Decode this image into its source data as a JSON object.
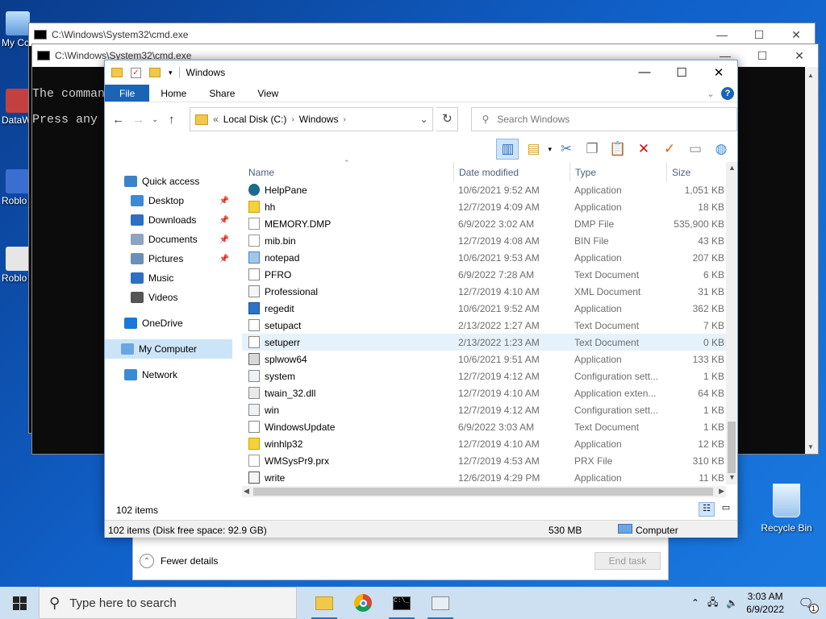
{
  "desktop": {
    "icons": [
      {
        "label": "My Co",
        "icon": "computer-icon"
      },
      {
        "label": "DataW",
        "icon": "app-icon"
      },
      {
        "label": "Roblo",
        "icon": "roblox-icon"
      },
      {
        "label": "Roblo",
        "icon": "roblox-icon"
      }
    ],
    "recycle_bin": "Recycle Bin"
  },
  "task_manager": {
    "fewer_details": "Fewer details",
    "end_task": "End task"
  },
  "cmd_back": {
    "title": "C:\\Windows\\System32\\cmd.exe"
  },
  "cmd_front": {
    "title": "C:\\Windows\\System32\\cmd.exe",
    "lines": [
      "The command",
      "Press any k"
    ]
  },
  "explorer": {
    "title": "Windows",
    "ribbon_tabs": [
      "File",
      "Home",
      "Share",
      "View"
    ],
    "address": {
      "prefix": "«",
      "crumbs": [
        "Local Disk (C:)",
        "Windows"
      ]
    },
    "search_placeholder": "Search Windows",
    "nav": [
      {
        "label": "Quick access",
        "icon": "star-icon"
      },
      {
        "label": "Desktop",
        "icon": "desktop-icon",
        "pinned": true
      },
      {
        "label": "Downloads",
        "icon": "download-icon",
        "pinned": true
      },
      {
        "label": "Documents",
        "icon": "document-icon",
        "pinned": true
      },
      {
        "label": "Pictures",
        "icon": "picture-icon",
        "pinned": true
      },
      {
        "label": "Music",
        "icon": "music-icon"
      },
      {
        "label": "Videos",
        "icon": "video-icon"
      },
      {
        "label": "OneDrive",
        "icon": "cloud-icon"
      },
      {
        "label": "My Computer",
        "icon": "computer-icon",
        "selected": true
      },
      {
        "label": "Network",
        "icon": "network-icon"
      }
    ],
    "columns": [
      "Name",
      "Date modified",
      "Type",
      "Size"
    ],
    "files": [
      {
        "name": "HelpPane",
        "date": "10/6/2021 9:52 AM",
        "type": "Application",
        "size": "1,051 KB",
        "icon": "help-icon"
      },
      {
        "name": "hh",
        "date": "12/7/2019 4:09 AM",
        "type": "Application",
        "size": "18 KB",
        "icon": "help-question-icon"
      },
      {
        "name": "MEMORY.DMP",
        "date": "6/9/2022 3:02 AM",
        "type": "DMP File",
        "size": "535,900 KB",
        "icon": "file-icon"
      },
      {
        "name": "mib.bin",
        "date": "12/7/2019 4:08 AM",
        "type": "BIN File",
        "size": "43 KB",
        "icon": "file-icon"
      },
      {
        "name": "notepad",
        "date": "10/6/2021 9:53 AM",
        "type": "Application",
        "size": "207 KB",
        "icon": "notepad-icon"
      },
      {
        "name": "PFRO",
        "date": "6/9/2022 7:28 AM",
        "type": "Text Document",
        "size": "6 KB",
        "icon": "text-file-icon"
      },
      {
        "name": "Professional",
        "date": "12/7/2019 4:10 AM",
        "type": "XML Document",
        "size": "31 KB",
        "icon": "xml-file-icon"
      },
      {
        "name": "regedit",
        "date": "10/6/2021 9:52 AM",
        "type": "Application",
        "size": "362 KB",
        "icon": "regedit-icon"
      },
      {
        "name": "setupact",
        "date": "2/13/2022 1:27 AM",
        "type": "Text Document",
        "size": "7 KB",
        "icon": "text-file-icon"
      },
      {
        "name": "setuperr",
        "date": "2/13/2022 1:23 AM",
        "type": "Text Document",
        "size": "0 KB",
        "icon": "text-file-icon",
        "highlight": true
      },
      {
        "name": "splwow64",
        "date": "10/6/2021 9:51 AM",
        "type": "Application",
        "size": "133 KB",
        "icon": "printer-icon"
      },
      {
        "name": "system",
        "date": "12/7/2019 4:12 AM",
        "type": "Configuration sett...",
        "size": "1 KB",
        "icon": "config-file-icon"
      },
      {
        "name": "twain_32.dll",
        "date": "12/7/2019 4:10 AM",
        "type": "Application exten...",
        "size": "64 KB",
        "icon": "dll-file-icon"
      },
      {
        "name": "win",
        "date": "12/7/2019 4:12 AM",
        "type": "Configuration sett...",
        "size": "1 KB",
        "icon": "config-file-icon"
      },
      {
        "name": "WindowsUpdate",
        "date": "6/9/2022 3:03 AM",
        "type": "Text Document",
        "size": "1 KB",
        "icon": "text-file-icon"
      },
      {
        "name": "winhlp32",
        "date": "12/7/2019 4:10 AM",
        "type": "Application",
        "size": "12 KB",
        "icon": "help-question-icon"
      },
      {
        "name": "WMSysPr9.prx",
        "date": "12/7/2019 4:53 AM",
        "type": "PRX File",
        "size": "310 KB",
        "icon": "file-icon"
      },
      {
        "name": "write",
        "date": "12/6/2019 4:29 PM",
        "type": "Application",
        "size": "11 KB",
        "icon": "write-icon"
      }
    ],
    "item_count": "102 items",
    "status": {
      "left": "102 items (Disk free space: 92.9 GB)",
      "size": "530 MB",
      "location": "Computer"
    }
  },
  "taskbar": {
    "search_placeholder": "Type here to search",
    "apps": [
      "file-explorer-icon",
      "chrome-icon",
      "cmd-icon",
      "task-manager-icon"
    ],
    "time": "3:03 AM",
    "date": "6/9/2022",
    "notifications": "1"
  }
}
